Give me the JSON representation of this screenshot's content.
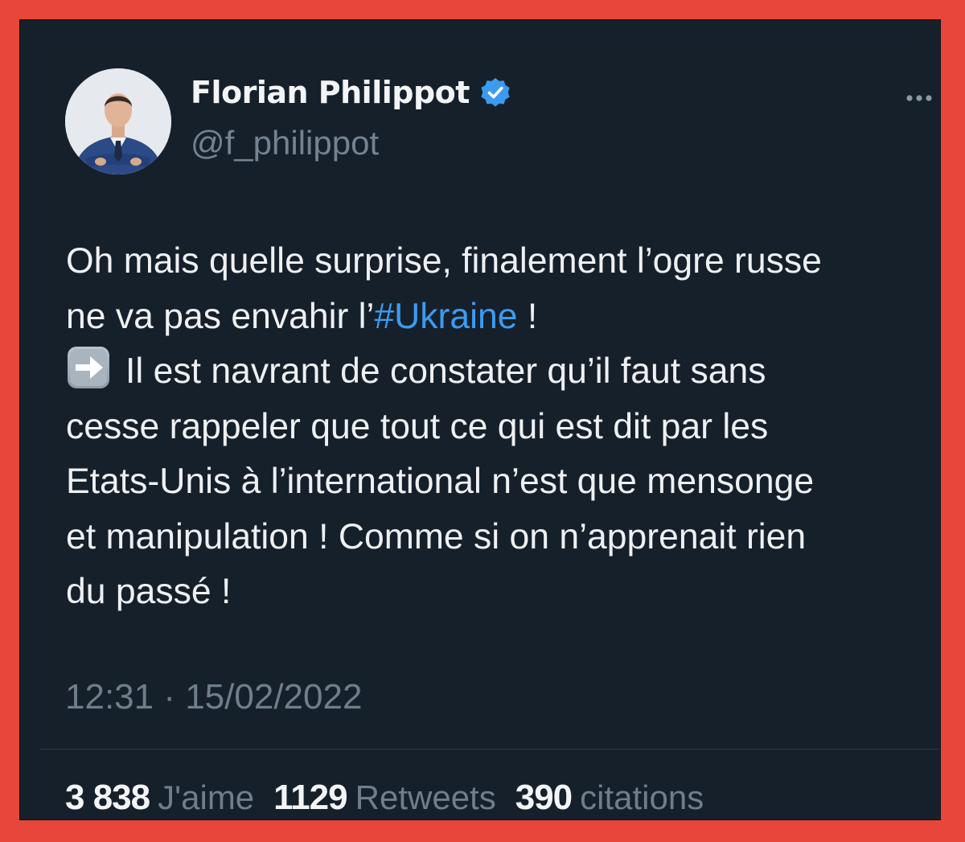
{
  "author": {
    "display_name": "Florian Philippot",
    "handle": "@f_philippot",
    "verified": true
  },
  "tweet": {
    "lines": [
      {
        "text": "Oh mais quelle surprise, finalement l’ogre russe"
      },
      {
        "before": "ne va pas envahir l’",
        "hashtag": "#Ukraine",
        "after": " !"
      },
      {
        "emoji": "arrow-right-icon",
        "text": "Il est navrant de constater qu’il faut sans"
      },
      {
        "text": "cesse rappeler que tout ce qui est dit par les"
      },
      {
        "text": "Etats-Unis à l’international n’est que mensonge"
      },
      {
        "text": "et manipulation ! Comme si on n’apprenait rien"
      },
      {
        "text": "du passé !"
      }
    ],
    "timestamp": "12:31 · 15/02/2022"
  },
  "stats": {
    "likes": {
      "count": "3 838",
      "label": "J'aime"
    },
    "retweets": {
      "count": "1129",
      "label": "Retweets"
    },
    "quotes": {
      "count": "390",
      "label": "citations"
    }
  },
  "colors": {
    "background": "#16202b",
    "frame": "#e8463a",
    "accent": "#3b9bf0",
    "muted": "#6f7e8b",
    "text": "#eef0f2"
  }
}
